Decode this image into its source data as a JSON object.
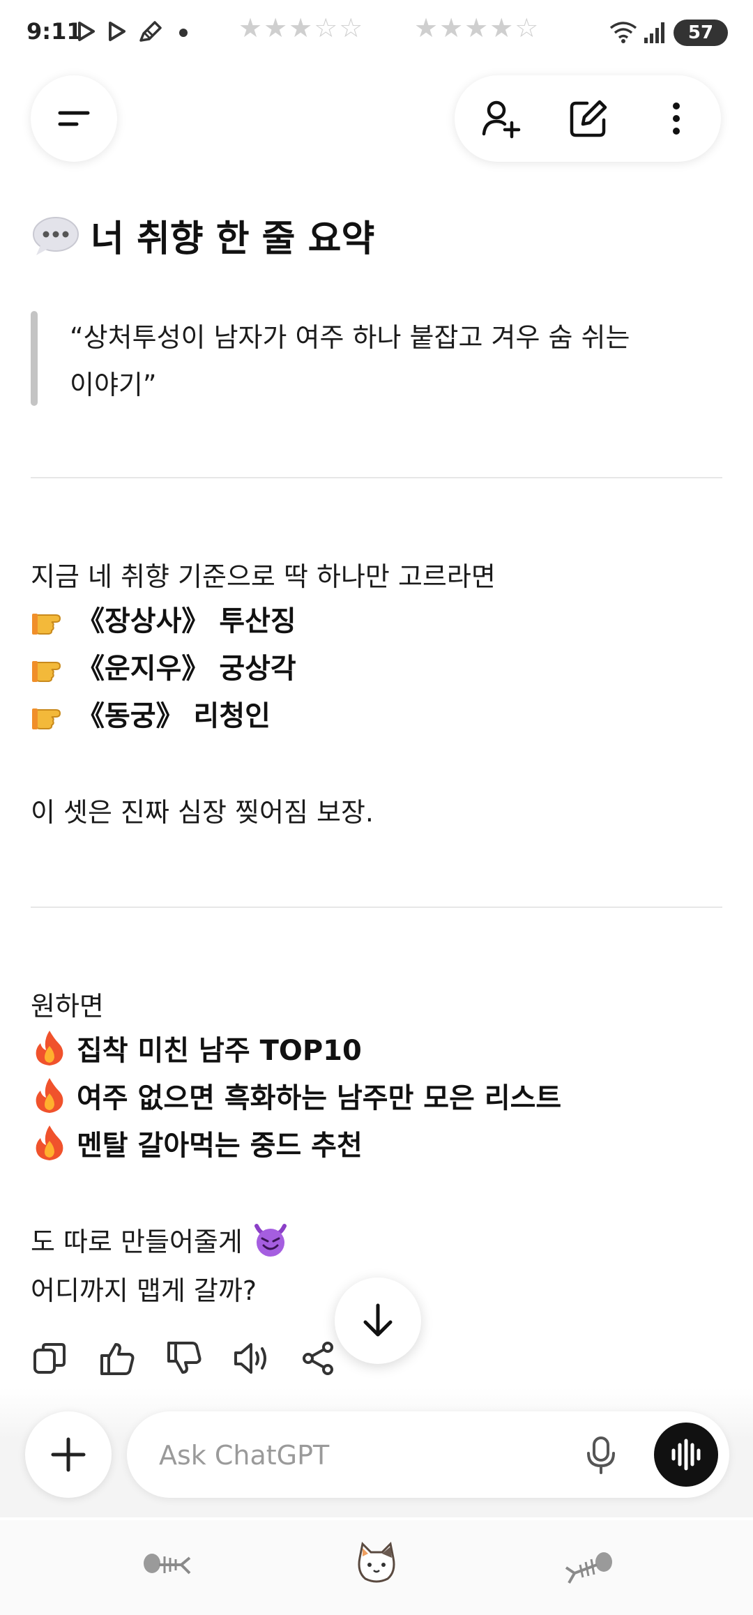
{
  "status_bar": {
    "time": "9:11",
    "battery": "57",
    "icons": [
      "play-icon",
      "play-icon",
      "pencil-icon",
      "dot-icon",
      "wifi-icon",
      "signal-icon",
      "battery-icon"
    ]
  },
  "toolbar": {
    "icons": [
      "menu-icon",
      "add-person-icon",
      "edit-icon",
      "more-vertical-icon"
    ]
  },
  "message": {
    "heading": "너 취향 한 줄 요약",
    "quote_line1": "“상처투성이 남자가 여주 하나 붙잡고 겨우 숨 쉬는",
    "quote_line2": "이야기”",
    "intro": "지금 네 취향 기준으로 딱 하나만 고르라면",
    "picks": [
      "《장상사》 투산징",
      "《운지우》 궁상각",
      "《동궁》 리청인"
    ],
    "picks_note": "이 셋은 진짜 심장 찢어짐 보장.",
    "offer_intro": "원하면",
    "offers": [
      "집착 미친 남주 TOP10",
      "여주 없으면 흑화하는 남주만 모은 리스트",
      "멘탈 갈아먹는 중드 추천"
    ],
    "closing_line1": "도 따로 만들어줄게",
    "closing_line2": "어디까지 맵게 갈까?"
  },
  "actions": [
    "copy-icon",
    "thumbs-up-icon",
    "thumbs-down-icon",
    "read-aloud-icon",
    "share-icon"
  ],
  "composer": {
    "placeholder": "Ask ChatGPT"
  },
  "nav": [
    "fish-bone-icon",
    "cat-icon",
    "fish-bone-icon"
  ]
}
